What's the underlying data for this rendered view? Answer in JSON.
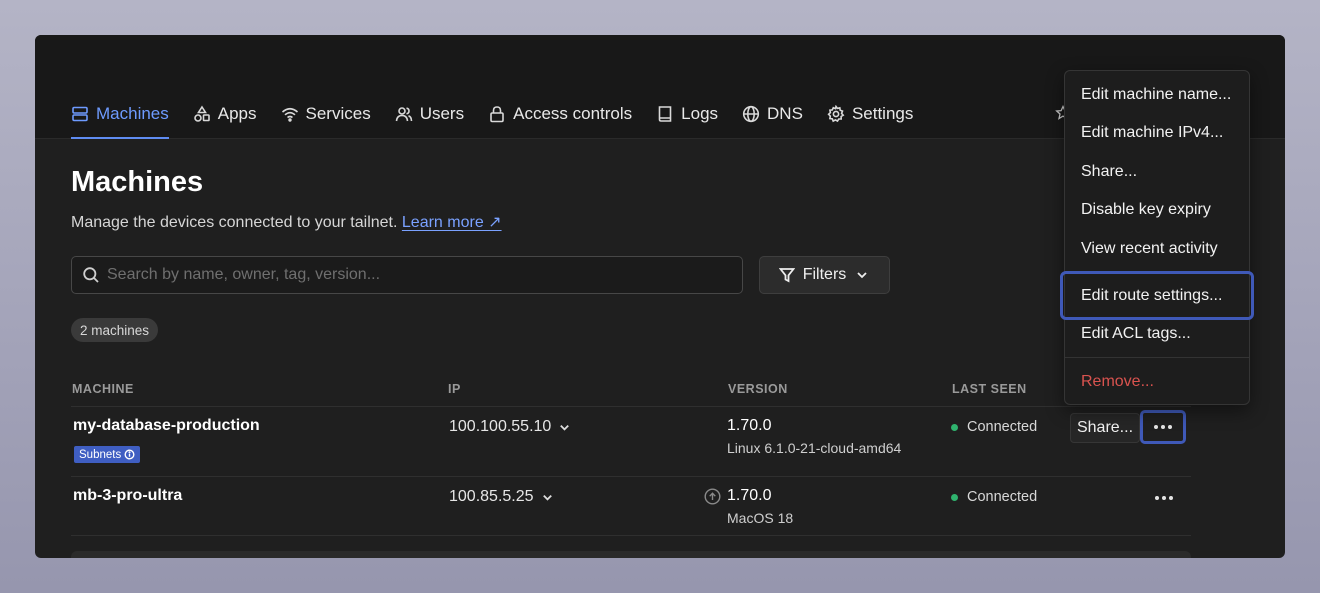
{
  "nav": {
    "items": [
      {
        "label": "Machines",
        "icon": "server-icon",
        "active": true
      },
      {
        "label": "Apps",
        "icon": "apps-icon"
      },
      {
        "label": "Services",
        "icon": "wifi-icon"
      },
      {
        "label": "Users",
        "icon": "users-icon"
      },
      {
        "label": "Access controls",
        "icon": "lock-icon"
      },
      {
        "label": "Logs",
        "icon": "book-icon"
      },
      {
        "label": "DNS",
        "icon": "globe-icon"
      },
      {
        "label": "Settings",
        "icon": "gear-icon"
      }
    ]
  },
  "page": {
    "title": "Machines",
    "subtitle": "Manage the devices connected to your tailnet.",
    "learn_more": "Learn more ↗"
  },
  "search": {
    "placeholder": "Search by name, owner, tag, version...",
    "value": ""
  },
  "filters": {
    "label": "Filters"
  },
  "count_badge": "2 machines",
  "table": {
    "headers": {
      "machine": "MACHINE",
      "ip": "IP",
      "version": "VERSION",
      "last_seen": "LAST SEEN"
    },
    "rows": [
      {
        "name": "my-database-production",
        "badge": "Subnets",
        "ip": "100.100.55.10",
        "version": "1.70.0",
        "os": "Linux 6.1.0-21-cloud-amd64",
        "status": "Connected",
        "share_label": "Share..."
      },
      {
        "name": "mb-3-pro-ultra",
        "ip": "100.85.5.25",
        "version": "1.70.0",
        "os": "MacOS 18",
        "status": "Connected",
        "update_available": true
      }
    ]
  },
  "context_menu": {
    "items": [
      "Edit machine name...",
      "Edit machine IPv4...",
      "Share...",
      "Disable key expiry",
      "View recent activity",
      "Edit route settings...",
      "Edit ACL tags...",
      "Remove..."
    ],
    "highlighted_item": "Edit route settings..."
  },
  "colors": {
    "accent": "#6e9bff",
    "background": "#1f1f1f",
    "status_connected": "#2fb36e",
    "danger": "#d9534f",
    "highlight": "#3f59b8"
  }
}
